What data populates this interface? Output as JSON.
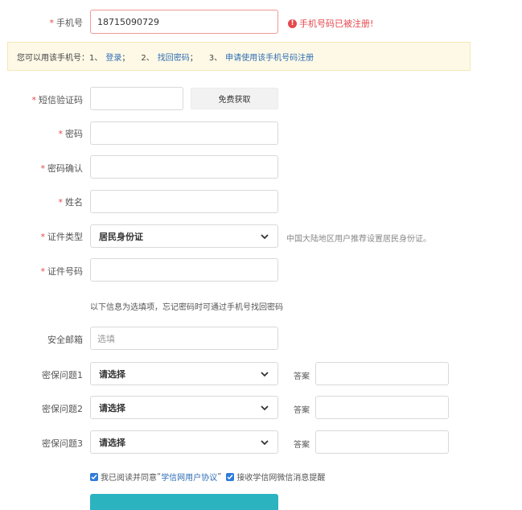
{
  "form": {
    "phone": {
      "label": "手机号",
      "value": "18715090729",
      "error": "手机号码已被注册!"
    },
    "notice": {
      "prefix": "您可以用该手机号：",
      "n1": "1、",
      "login": "登录",
      "sep1": "；",
      "n2": "2、",
      "recover": "找回密码",
      "sep2": "；",
      "n3": "3、",
      "apply": "申请使用该手机号码注册"
    },
    "sms": {
      "label": "短信验证码",
      "button": "免费获取"
    },
    "password": {
      "label": "密码"
    },
    "password_confirm": {
      "label": "密码确认"
    },
    "name": {
      "label": "姓名"
    },
    "id_type": {
      "label": "证件类型",
      "value": "居民身份证",
      "hint": "中国大陆地区用户推荐设置居民身份证。"
    },
    "id_number": {
      "label": "证件号码"
    },
    "optional_note": "以下信息为选填项，忘记密码时可通过手机号找回密码",
    "email": {
      "label": "安全邮箱",
      "placeholder": "选填"
    },
    "questions": [
      {
        "label": "密保问题1",
        "value": "请选择",
        "answer_label": "答案"
      },
      {
        "label": "密保问题2",
        "value": "请选择",
        "answer_label": "答案"
      },
      {
        "label": "密保问题3",
        "value": "请选择",
        "answer_label": "答案"
      }
    ],
    "agree": {
      "text1": "我已阅读并同意",
      "quote_open": "“",
      "link": "学信网用户协议",
      "quote_close": "”",
      "text2": "接收学信网微信消息提醒"
    }
  },
  "colors": {
    "required": "#e5484d",
    "link": "#2f6db5",
    "notice_bg": "#fdf9e6",
    "submit": "#2bb3c0"
  }
}
